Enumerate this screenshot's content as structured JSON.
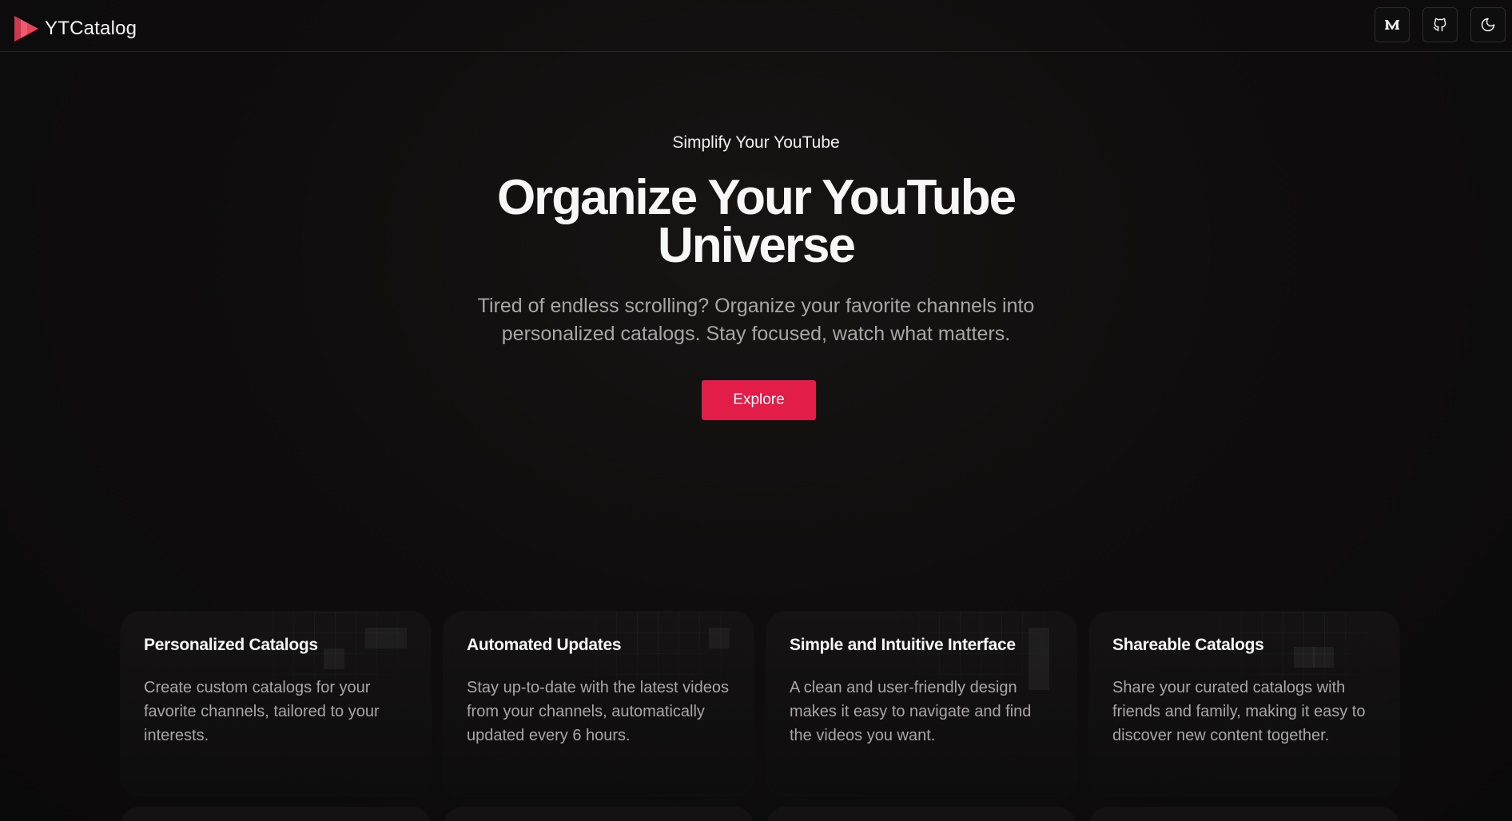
{
  "header": {
    "brand": "YTCatalog",
    "buttons": [
      {
        "icon": "medium-icon"
      },
      {
        "icon": "github-icon"
      },
      {
        "icon": "moon-icon"
      }
    ]
  },
  "hero": {
    "eyebrow": "Simplify Your YouTube",
    "headline_line1": "Organize Your YouTube",
    "headline_line2": "Universe",
    "subtitle_line1": "Tired of endless scrolling? Organize your favorite channels into",
    "subtitle_line2": "personalized catalogs. Stay focused, watch what matters.",
    "cta": "Explore"
  },
  "features": [
    {
      "title": "Personalized Catalogs",
      "description": "Create custom catalogs for your favorite channels, tailored to your interests."
    },
    {
      "title": "Automated Updates",
      "description": "Stay up-to-date with the latest videos from your channels, automatically updated every 6 hours."
    },
    {
      "title": "Simple and Intuitive Interface",
      "description": "A clean and user-friendly design makes it easy to navigate and find the videos you want."
    },
    {
      "title": "Shareable Catalogs",
      "description": "Share your curated catalogs with friends and family, making it easy to discover new content together."
    }
  ],
  "colors": {
    "accent": "#e11d48",
    "background": "#0c0b0b",
    "muted_text": "#a9a6a6"
  }
}
